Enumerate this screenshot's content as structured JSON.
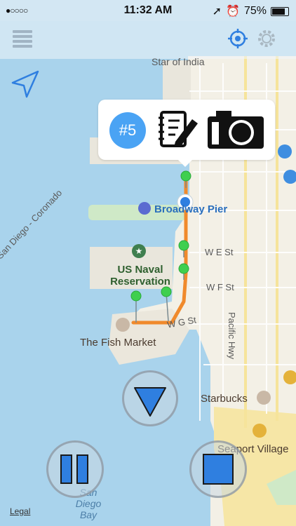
{
  "status_bar": {
    "signal": "●○○○○",
    "time": "11:32 AM",
    "battery": "75%"
  },
  "navbar": {
    "menu_icon": "hamburger-icon",
    "target_icon": "crosshair-target-icon",
    "settings_icon": "gear-icon"
  },
  "popup": {
    "badge": "#5",
    "notepad_icon": "notepad-icon",
    "camera_icon": "camera-icon"
  },
  "map": {
    "labels": {
      "star_of_india": "Star of India",
      "broadway_pier": "Broadway Pier",
      "coronado": "San Diego - Coronado",
      "naval": "US Naval Reservation",
      "w_e_st": "W E St",
      "w_f_st": "W F St",
      "w_g_st": "W G St",
      "fish_market": "The Fish Market",
      "pacific_hwy": "Pacific Hwy",
      "starbucks": "Starbucks",
      "seaport_village": "Seaport Village",
      "san_diego_bay": "San Diego Bay"
    },
    "colors": {
      "water": "#a9d3ec",
      "land": "#f3f0e6",
      "route": "#f08a2c",
      "waypoint": "#3fcf4f"
    }
  },
  "controls": {
    "down_button": "down-triangle-button",
    "pause_button": "pause-button",
    "stop_button": "stop-button",
    "accent": "#2f7fe0"
  },
  "legal": "Legal"
}
